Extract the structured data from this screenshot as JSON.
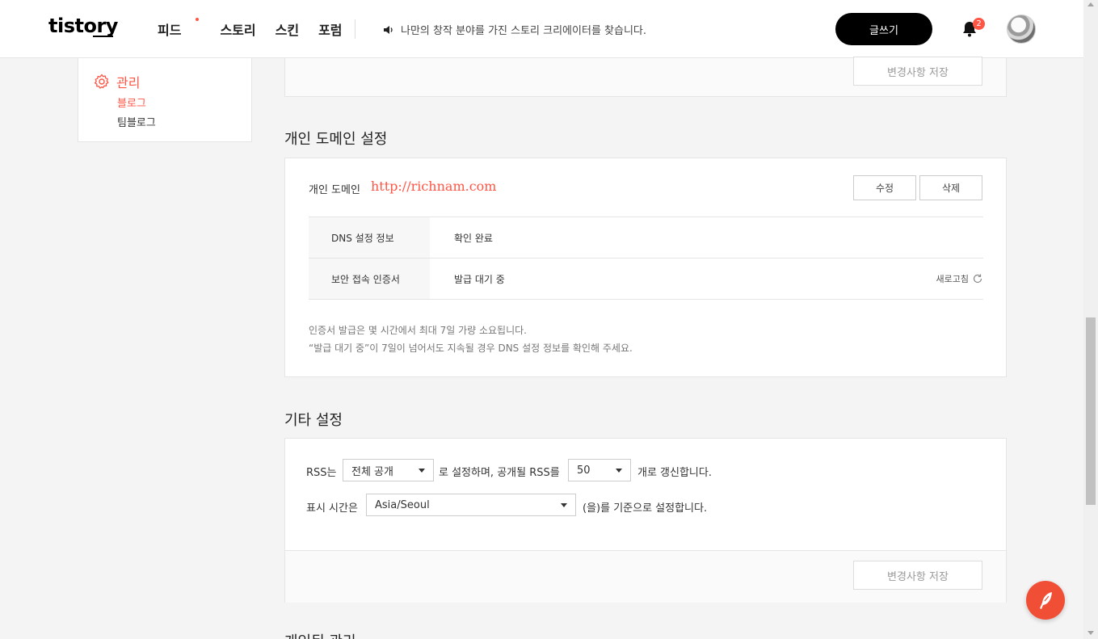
{
  "header": {
    "logo": "tistory",
    "nav": [
      "피드",
      "스토리",
      "스킨",
      "포럼"
    ],
    "notice": "나만의 창작 분야를 가진 스토리 크리에이터를 찾습니다.",
    "write_button": "글쓰기",
    "notification_count": "2"
  },
  "sidebar": {
    "title": "관리",
    "items": [
      "블로그",
      "팀블로그"
    ],
    "accent": "#ff5544"
  },
  "top_section": {
    "save_button": "변경사항 저장"
  },
  "domain_section": {
    "title": "개인 도메인 설정",
    "label": "개인 도메인",
    "url": "http://richnam.com",
    "edit_button": "수정",
    "delete_button": "삭제",
    "rows": [
      {
        "key": "DNS 설정 정보",
        "value": "확인 완료"
      },
      {
        "key": "보안 접속 인증서",
        "value": "발급 대기 중"
      }
    ],
    "refresh": "새로고침",
    "notes": [
      "인증서 발급은 몇 시간에서 최대 7일 가량 소요됩니다.",
      "“발급 대기 중”이 7일이 넘어서도 지속될 경우 DNS 설정 정보를 확인해 주세요."
    ]
  },
  "etc_section": {
    "title": "기타 설정",
    "rss_prefix": "RSS는",
    "rss_scope": "전체 공개",
    "rss_middle": "로 설정하며, 공개될 RSS를",
    "rss_count": "50",
    "rss_suffix": "개로 갱신합니다.",
    "time_prefix": "표시 시간은",
    "timezone": "Asia/Seoul",
    "time_suffix": "(을)를 기준으로 설정합니다.",
    "save_button": "변경사항 저장"
  },
  "next_section": {
    "title": "개인된 관리"
  }
}
